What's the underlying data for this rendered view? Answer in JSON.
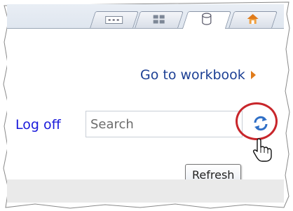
{
  "tabs": [
    {
      "icon": "list-icon"
    },
    {
      "icon": "grid-icon"
    },
    {
      "icon": "database-icon",
      "active": true
    },
    {
      "icon": "home-icon"
    }
  ],
  "goto_workbook": {
    "label": "Go to workbook",
    "icon": "arrow-right-icon",
    "arrow_color": "#e07b1a"
  },
  "logoff": {
    "label": "Log off"
  },
  "search": {
    "placeholder": "Search",
    "value": ""
  },
  "refresh": {
    "icon": "refresh-icon",
    "tooltip": "Refresh",
    "highlight_color": "#c8262b"
  },
  "colors": {
    "link": "#1c3f94",
    "logoff_link": "#1a1adb",
    "accent_arrow": "#e07b1a"
  }
}
